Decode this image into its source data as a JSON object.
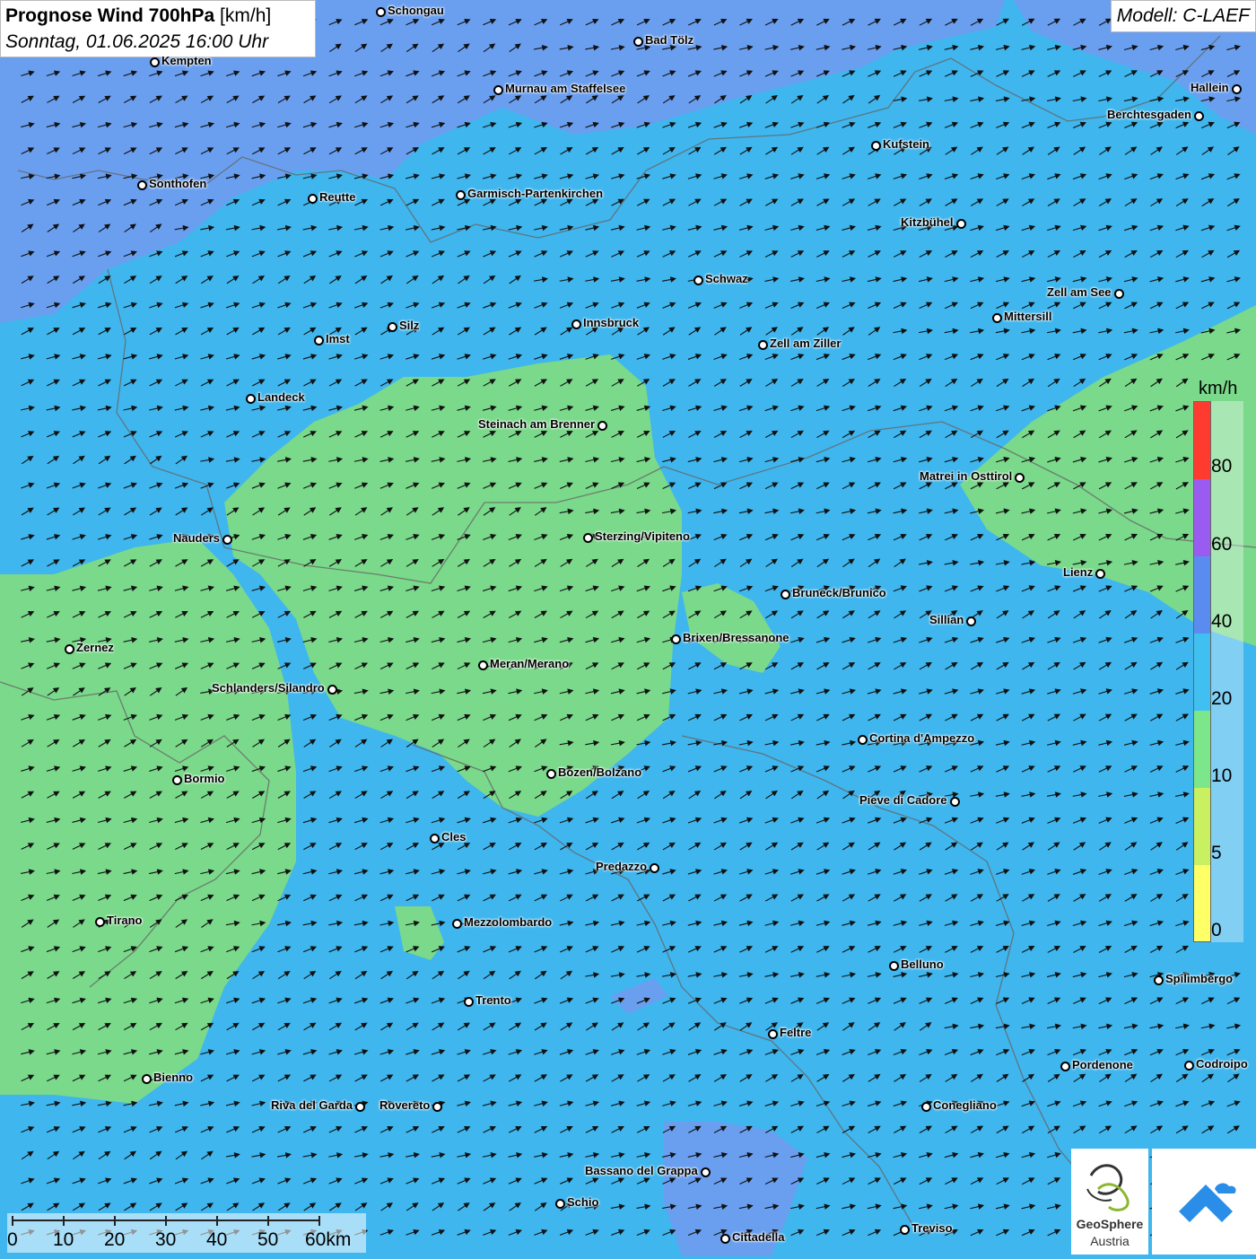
{
  "title": {
    "main": "Prognose Wind 700hPa",
    "unit": "[km/h]",
    "date": "Sonntag, 01.06.2025 16:00 Uhr"
  },
  "model": "Modell: C-LAEF",
  "legend": {
    "unit": "km/h",
    "labels": [
      "80",
      "60",
      "40",
      "20",
      "10",
      "5",
      "0"
    ],
    "colors": [
      "#ff3b30",
      "#9a5cf0",
      "#5a8cf0",
      "#3fc0f0",
      "#7ce68a",
      "#c8f060",
      "#ffff66"
    ]
  },
  "scale": {
    "labels": [
      "0",
      "10",
      "20",
      "30",
      "40",
      "50",
      "60km"
    ]
  },
  "logos": {
    "geosphere_line1": "GeoSphere",
    "geosphere_line2": "Austria"
  },
  "cities": [
    {
      "name": "Schongau"
    },
    {
      "name": "Bad Tölz"
    },
    {
      "name": "Kempten"
    },
    {
      "name": "Murnau am Staffelsee"
    },
    {
      "name": "Hallein"
    },
    {
      "name": "Berchtesgaden"
    },
    {
      "name": "Kufstein"
    },
    {
      "name": "Sonthofen"
    },
    {
      "name": "Reutte"
    },
    {
      "name": "Garmisch-Partenkirchen"
    },
    {
      "name": "Kitzbühel"
    },
    {
      "name": "Schwaz"
    },
    {
      "name": "Zell am See"
    },
    {
      "name": "Mittersill"
    },
    {
      "name": "Imst"
    },
    {
      "name": "Silz"
    },
    {
      "name": "Innsbruck"
    },
    {
      "name": "Zell am Ziller"
    },
    {
      "name": "Landeck"
    },
    {
      "name": "Steinach am Brenner"
    },
    {
      "name": "Matrei in Osttirol"
    },
    {
      "name": "Nauders"
    },
    {
      "name": "Sterzing/Vipiteno"
    },
    {
      "name": "Lienz"
    },
    {
      "name": "Bruneck/Brunico"
    },
    {
      "name": "Sillian"
    },
    {
      "name": "Zernez"
    },
    {
      "name": "Brixen/Bressanone"
    },
    {
      "name": "Meran/Merano"
    },
    {
      "name": "Schlanders/Silandro"
    },
    {
      "name": "Cortina d'Ampezzo"
    },
    {
      "name": "Bormio"
    },
    {
      "name": "Bozen/Bolzano"
    },
    {
      "name": "Pieve di Cadore"
    },
    {
      "name": "Cles"
    },
    {
      "name": "Predazzo"
    },
    {
      "name": "Tirano"
    },
    {
      "name": "Mezzolombardo"
    },
    {
      "name": "Belluno"
    },
    {
      "name": "Spilimbergo"
    },
    {
      "name": "Trento"
    },
    {
      "name": "Feltre"
    },
    {
      "name": "Pordenone"
    },
    {
      "name": "Codroipo"
    },
    {
      "name": "Bienno"
    },
    {
      "name": "Riva del Garda"
    },
    {
      "name": "Rovereto"
    },
    {
      "name": "Conegliano"
    },
    {
      "name": "Bassano del Grappa"
    },
    {
      "name": "Schio"
    },
    {
      "name": "Treviso"
    },
    {
      "name": "Cittadella"
    }
  ]
}
